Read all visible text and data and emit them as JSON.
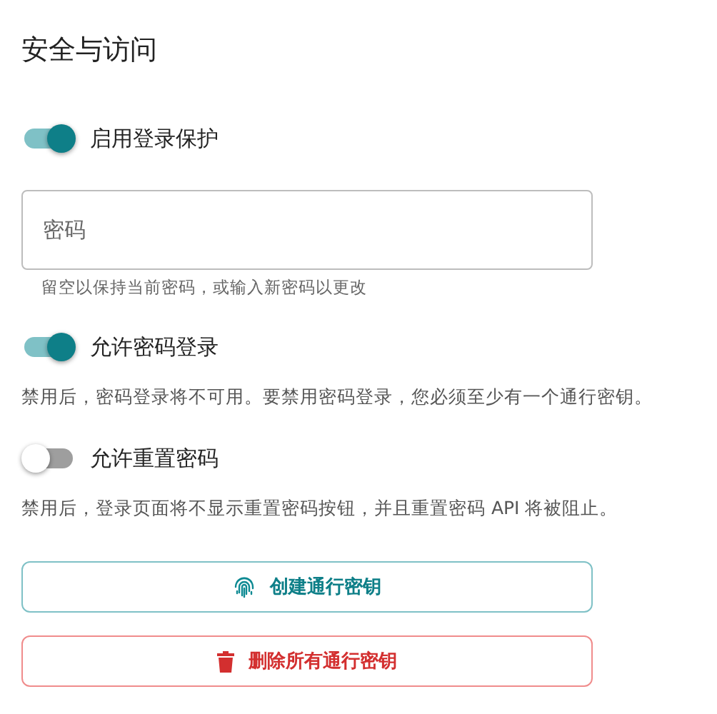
{
  "title": "安全与访问",
  "settings": [
    {
      "kind": "toggle",
      "label": "启用登录保护",
      "on": true
    },
    {
      "kind": "field",
      "placeholder": "密码",
      "hint": "留空以保持当前密码，或输入新密码以更改"
    },
    {
      "kind": "toggle",
      "label": "允许密码登录",
      "on": true,
      "description": "禁用后，密码登录将不可用。要禁用密码登录，您必须至少有一个通行密钥。"
    },
    {
      "kind": "toggle",
      "label": "允许重置密码",
      "on": false,
      "description": "禁用后，登录页面将不显示重置密码按钮，并且重置密码 API 将被阻止。"
    }
  ],
  "buttons": [
    {
      "kind": "create",
      "label": "创建通行密钥"
    },
    {
      "kind": "delete",
      "label": "删除所有通行密钥"
    }
  ]
}
